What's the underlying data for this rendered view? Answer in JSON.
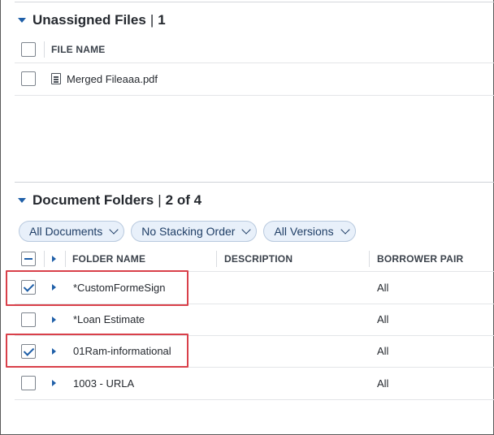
{
  "unassigned": {
    "title": "Unassigned Files",
    "separator": "|",
    "count": "1",
    "header": {
      "file_name": "FILE NAME"
    },
    "files": [
      {
        "name": "Merged Fileaaa.pdf",
        "checked": false
      }
    ]
  },
  "folders": {
    "title": "Document Folders",
    "separator": "|",
    "count": "2 of 4",
    "filters": [
      {
        "label": "All Documents"
      },
      {
        "label": "No Stacking Order"
      },
      {
        "label": "All Versions"
      }
    ],
    "headers": {
      "folder_name": "FOLDER NAME",
      "description": "DESCRIPTION",
      "borrower_pair": "BORROWER PAIR"
    },
    "rows": [
      {
        "name": "*CustomFormeSign",
        "description": "",
        "borrower_pair": "All",
        "checked": true
      },
      {
        "name": "*Loan Estimate",
        "description": "",
        "borrower_pair": "All",
        "checked": false
      },
      {
        "name": "01Ram-informational",
        "description": "",
        "borrower_pair": "All",
        "checked": true
      },
      {
        "name": "1003 - URLA",
        "description": "",
        "borrower_pair": "All",
        "checked": false
      }
    ]
  },
  "colors": {
    "accent": "#1f5fa8",
    "highlight": "#d9404a",
    "chip_bg": "#e8f0fa"
  },
  "icons": {
    "section_toggle": "caret-down-icon",
    "row_expand": "caret-right-icon",
    "file": "document-icon",
    "chip_dropdown": "chevron-down-icon"
  }
}
